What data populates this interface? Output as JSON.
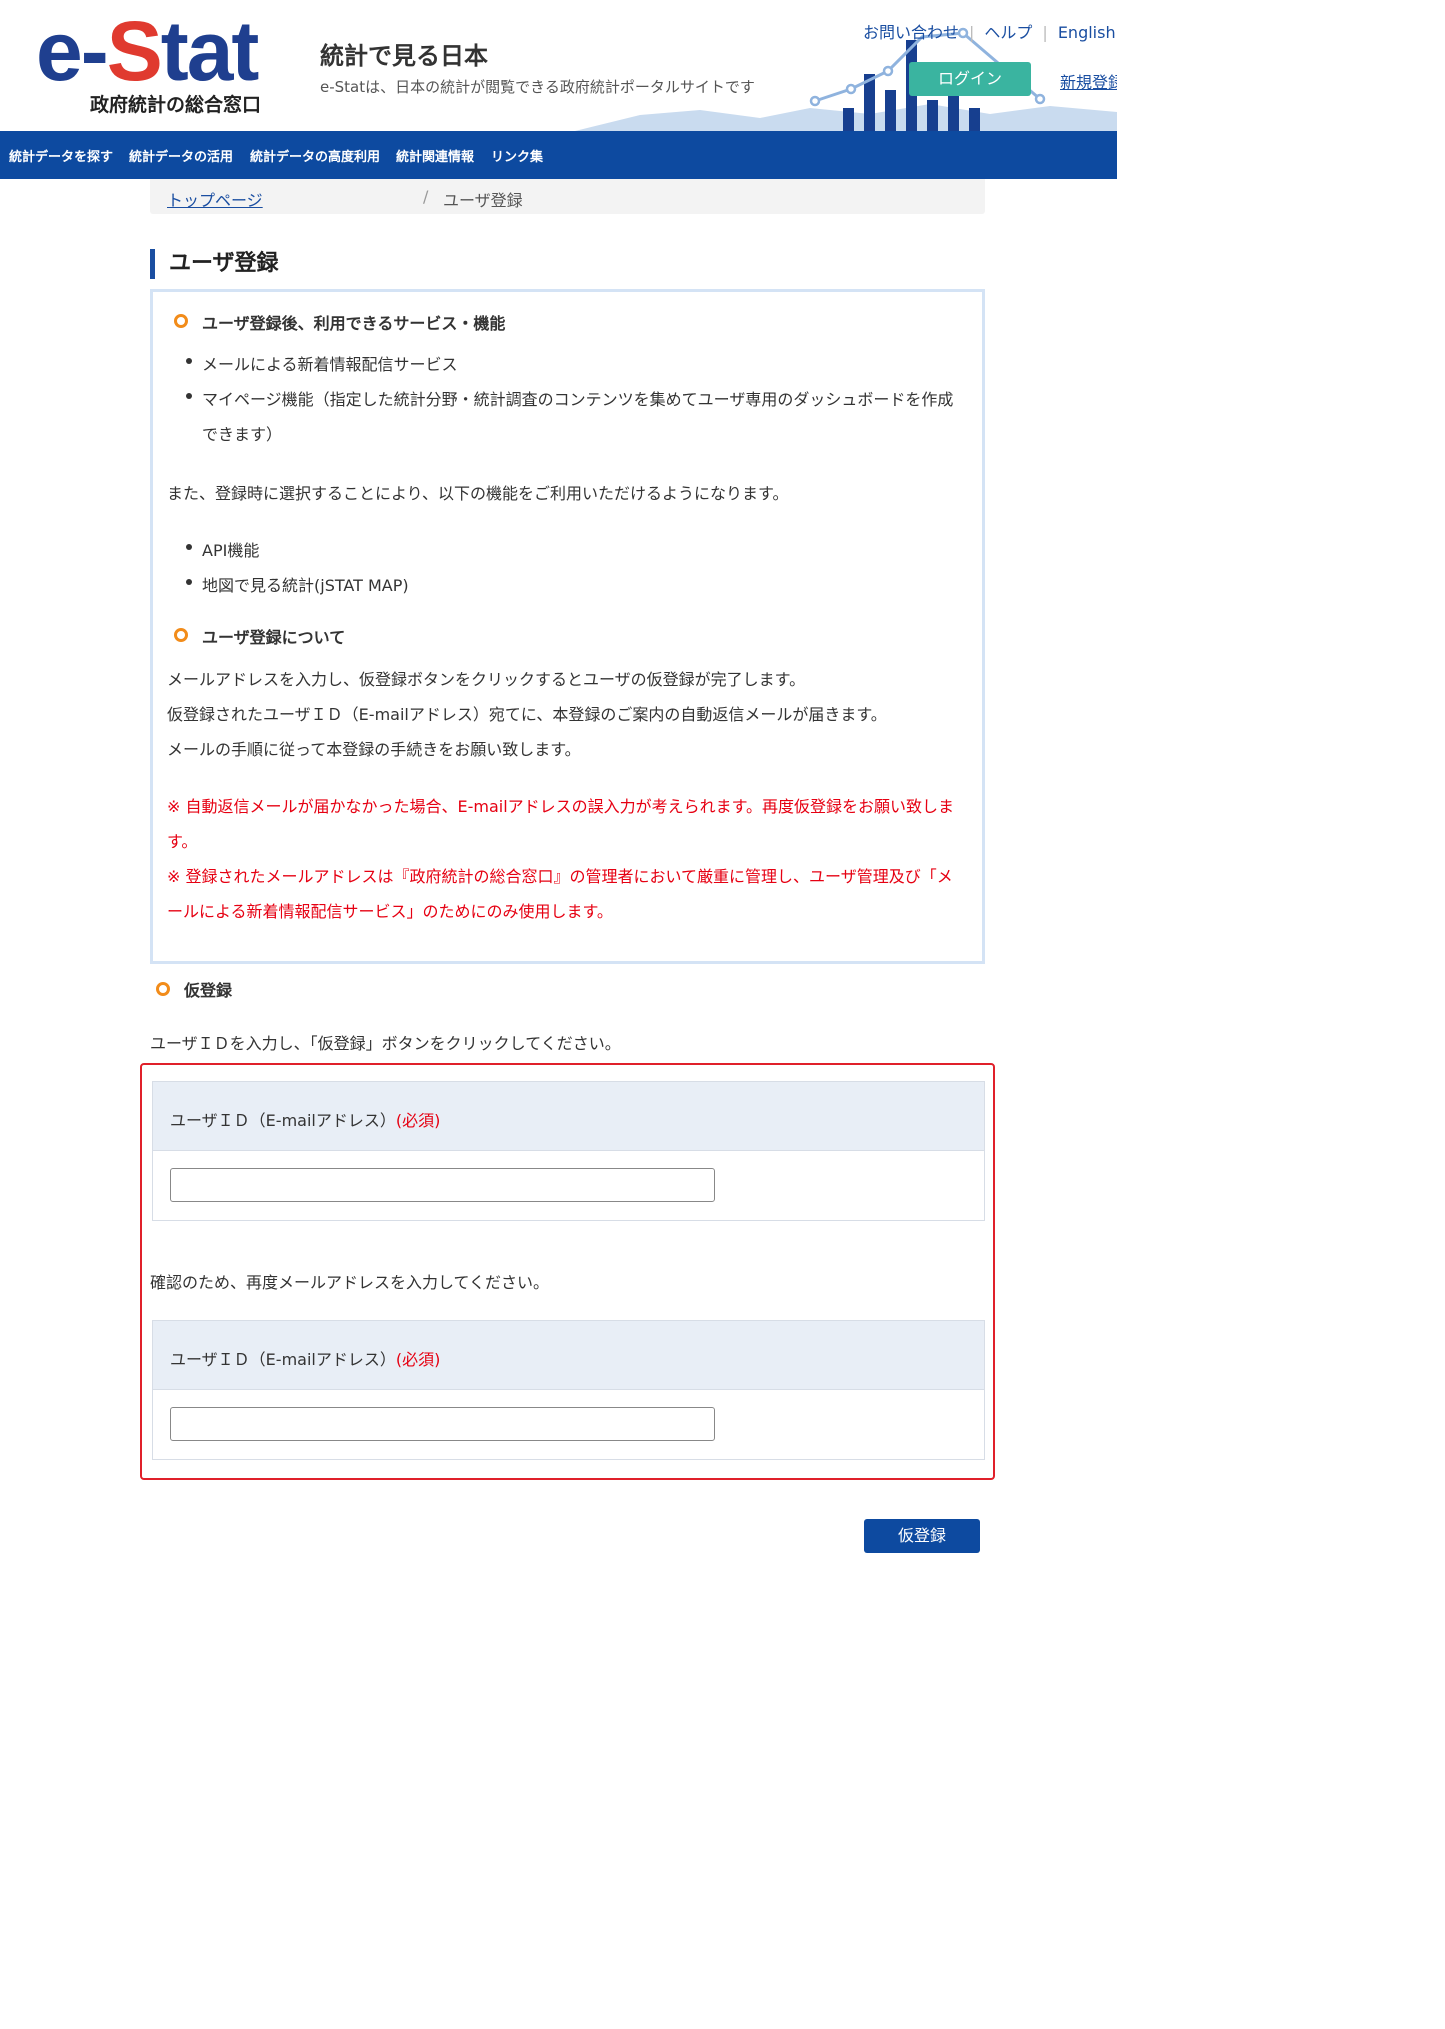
{
  "header": {
    "logo_text_prefix": "e-",
    "logo_text_s": "S",
    "logo_text_suffix": "tat",
    "logo_subtitle": "政府統計の総合窓口",
    "site_title": "統計で見る日本",
    "site_tagline": "e-Statは、日本の統計が閲覧できる政府統計ポータルサイトです",
    "links": {
      "contact": "お問い合わせ",
      "help": "ヘルプ",
      "english": "English",
      "separator": "|"
    },
    "login_label": "ログイン",
    "signup_label": "新規登録"
  },
  "nav": {
    "items": [
      "統計データを探す",
      "統計データの活用",
      "統計データの高度利用",
      "統計関連情報",
      "リンク集"
    ]
  },
  "breadcrumb": {
    "home": "トップページ",
    "separator": "/",
    "current": "ユーザ登録"
  },
  "page_title": "ユーザ登録",
  "info": {
    "services_heading": "ユーザ登録後、利用できるサービス・機能",
    "services": [
      "メールによる新着情報配信サービス",
      "マイページ機能（指定した統計分野・統計調査のコンテンツを集めてユーザ専用のダッシュボードを作成",
      "できます）"
    ],
    "also_text": "また、登録時に選択することにより、以下の機能をご利用いただけるようになります。",
    "optional_features": [
      "API機能",
      "地図で見る統計(jSTAT MAP)"
    ],
    "about_heading": "ユーザ登録について",
    "about_lines": [
      "メールアドレスを入力し、仮登録ボタンをクリックするとユーザの仮登録が完了します。",
      "仮登録されたユーザＩＤ（E-mailアドレス）宛てに、本登録のご案内の自動返信メールが届きます。",
      "メールの手順に従って本登録の手続きをお願い致します。"
    ],
    "notes": [
      "※ 自動返信メールが届かなかった場合、E-mailアドレスの誤入力が考えられます。再度仮登録をお願い致しま",
      "す。",
      "※ 登録されたメールアドレスは『政府統計の総合窓口』の管理者において厳重に管理し、ユーザ管理及び「メ",
      "ールによる新着情報配信サービス」のためにのみ使用します。"
    ]
  },
  "provisional": {
    "heading": "仮登録",
    "instruction": "ユーザＩＤを入力し、「仮登録」ボタンをクリックしてください。",
    "field_label": "ユーザＩＤ（E-mailアドレス）",
    "required_mark": "(必須)",
    "email_value": "",
    "confirm_instruction": "確認のため、再度メールアドレスを入力してください。",
    "confirm_value": "",
    "submit_label": "仮登録"
  },
  "colors": {
    "brand_blue": "#0d4aa0",
    "logo_red": "#e03a2f",
    "login_teal": "#3ab4a0",
    "required_red": "#e60012",
    "bullet_orange": "#f28c1a"
  }
}
